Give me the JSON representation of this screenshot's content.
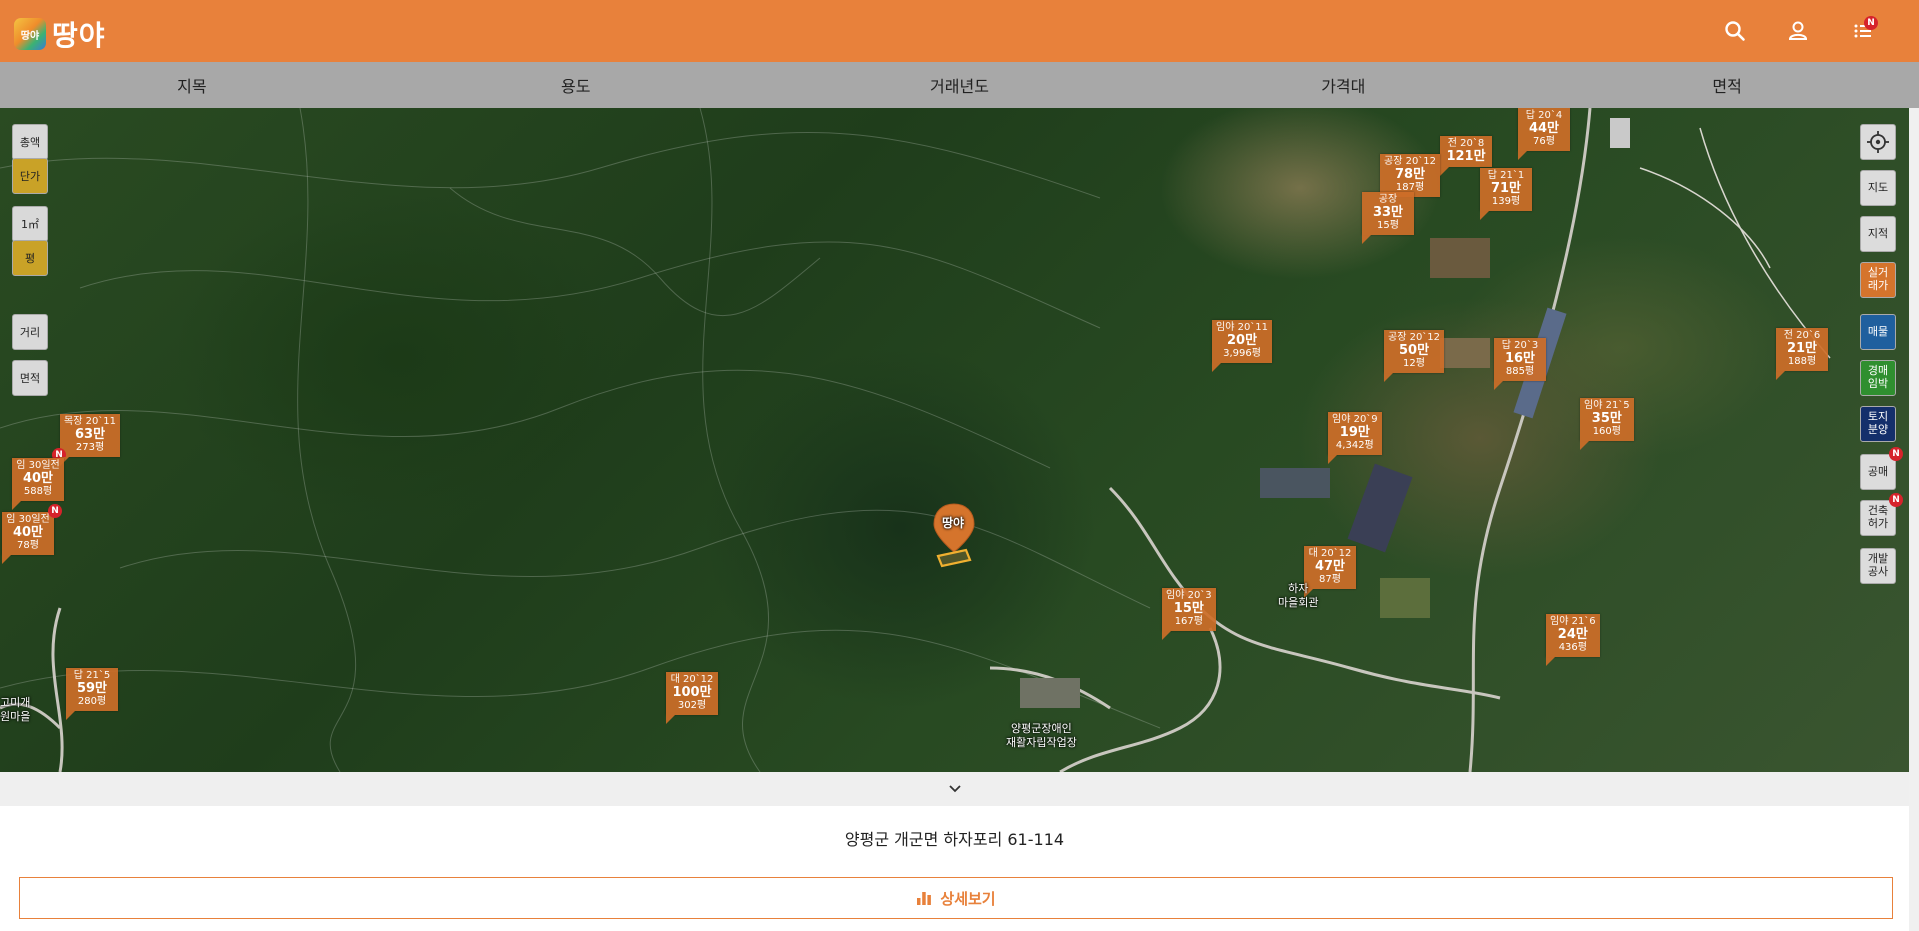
{
  "header": {
    "logo_text": "땅야",
    "logo_badge_text": "땅야",
    "new_badge": "N"
  },
  "filters": [
    "지목",
    "용도",
    "거래년도",
    "가격대",
    "면적"
  ],
  "left_controls": {
    "total": "총액",
    "unit_price": "단가",
    "sqm": "1㎡",
    "pyeong": "평",
    "distance": "거리",
    "area": "면적"
  },
  "right_controls": {
    "map": "지도",
    "cadastral": "지적",
    "real_deal_1": "실거",
    "real_deal_2": "래가",
    "listing": "매물",
    "auction_1": "경매",
    "auction_2": "임박",
    "land_sale_1": "토지",
    "land_sale_2": "분양",
    "public_sale": "공매",
    "permit_1": "건축",
    "permit_2": "허가",
    "dev_1": "개발",
    "dev_2": "공사",
    "new_badge": "N"
  },
  "map": {
    "pin_text": "땅야",
    "tags": [
      {
        "type": "답 20`4",
        "price": "44만",
        "area": "76평"
      },
      {
        "type": "전 20`8",
        "price": "121만",
        "area": ""
      },
      {
        "type": "공장 20`12",
        "price": "78만",
        "area": "187평"
      },
      {
        "type": "공장",
        "price": "33만",
        "area": "15평"
      },
      {
        "type": "답 21`1",
        "price": "71만",
        "area": "139평"
      },
      {
        "type": "임야 20`11",
        "price": "20만",
        "area": "3,996평"
      },
      {
        "type": "공장 20`12",
        "price": "50만",
        "area": "12평"
      },
      {
        "type": "답 20`3",
        "price": "16만",
        "area": "885평"
      },
      {
        "type": "전 20`6",
        "price": "21만",
        "area": "188평"
      },
      {
        "type": "임야 21`5",
        "price": "35만",
        "area": "160평"
      },
      {
        "type": "임야 20`9",
        "price": "19만",
        "area": "4,342평"
      },
      {
        "type": "목장 20`11",
        "price": "63만",
        "area": "273평"
      },
      {
        "type": "임 30일전",
        "price": "40만",
        "area": "588평"
      },
      {
        "type": "임 30일전",
        "price": "40만",
        "area": "78평"
      },
      {
        "type": "대 20`12",
        "price": "47만",
        "area": "87평"
      },
      {
        "type": "임야 20`3",
        "price": "15만",
        "area": "167평"
      },
      {
        "type": "임야 21`6",
        "price": "24만",
        "area": "436평"
      },
      {
        "type": "답 21`5",
        "price": "59만",
        "area": "280평"
      },
      {
        "type": "대 20`12",
        "price": "100만",
        "area": "302평"
      }
    ],
    "places": {
      "workshop_1": "양평군장애인",
      "workshop_2": "재활자립작업장",
      "village_1": "하자",
      "village_2": "마을회관",
      "left_village_1": "고미개",
      "left_village_2": "원마을"
    }
  },
  "panel": {
    "address": "양평군 개군면 하자포리 61-114",
    "detail_button": "상세보기"
  },
  "colors": {
    "header": "#e8813b",
    "tag": "#cd6e28",
    "filter_bar": "#a8a8a8"
  }
}
